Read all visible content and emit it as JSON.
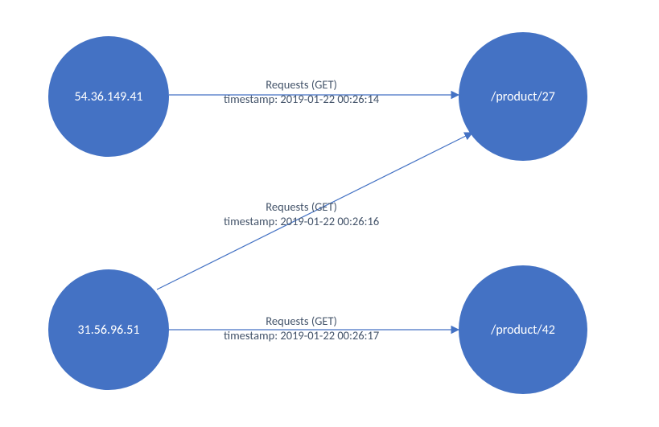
{
  "nodes": {
    "ip1": {
      "label": "54.36.149.41"
    },
    "ip2": {
      "label": "31.56.96.51"
    },
    "prod27": {
      "label": "/product/27"
    },
    "prod42": {
      "label": "/product/42"
    }
  },
  "edges": {
    "e1": {
      "line1": "Requests (GET)",
      "line2": "timestamp: 2019-01-22 00:26:14"
    },
    "e2": {
      "line1": "Requests (GET)",
      "line2": "timestamp: 2019-01-22 00:26:16"
    },
    "e3": {
      "line1": "Requests (GET)",
      "line2": "timestamp: 2019-01-22 00:26:17"
    }
  },
  "colors": {
    "node_fill": "#4472C4",
    "edge_stroke": "#4472C4",
    "label_text": "#44546A"
  }
}
